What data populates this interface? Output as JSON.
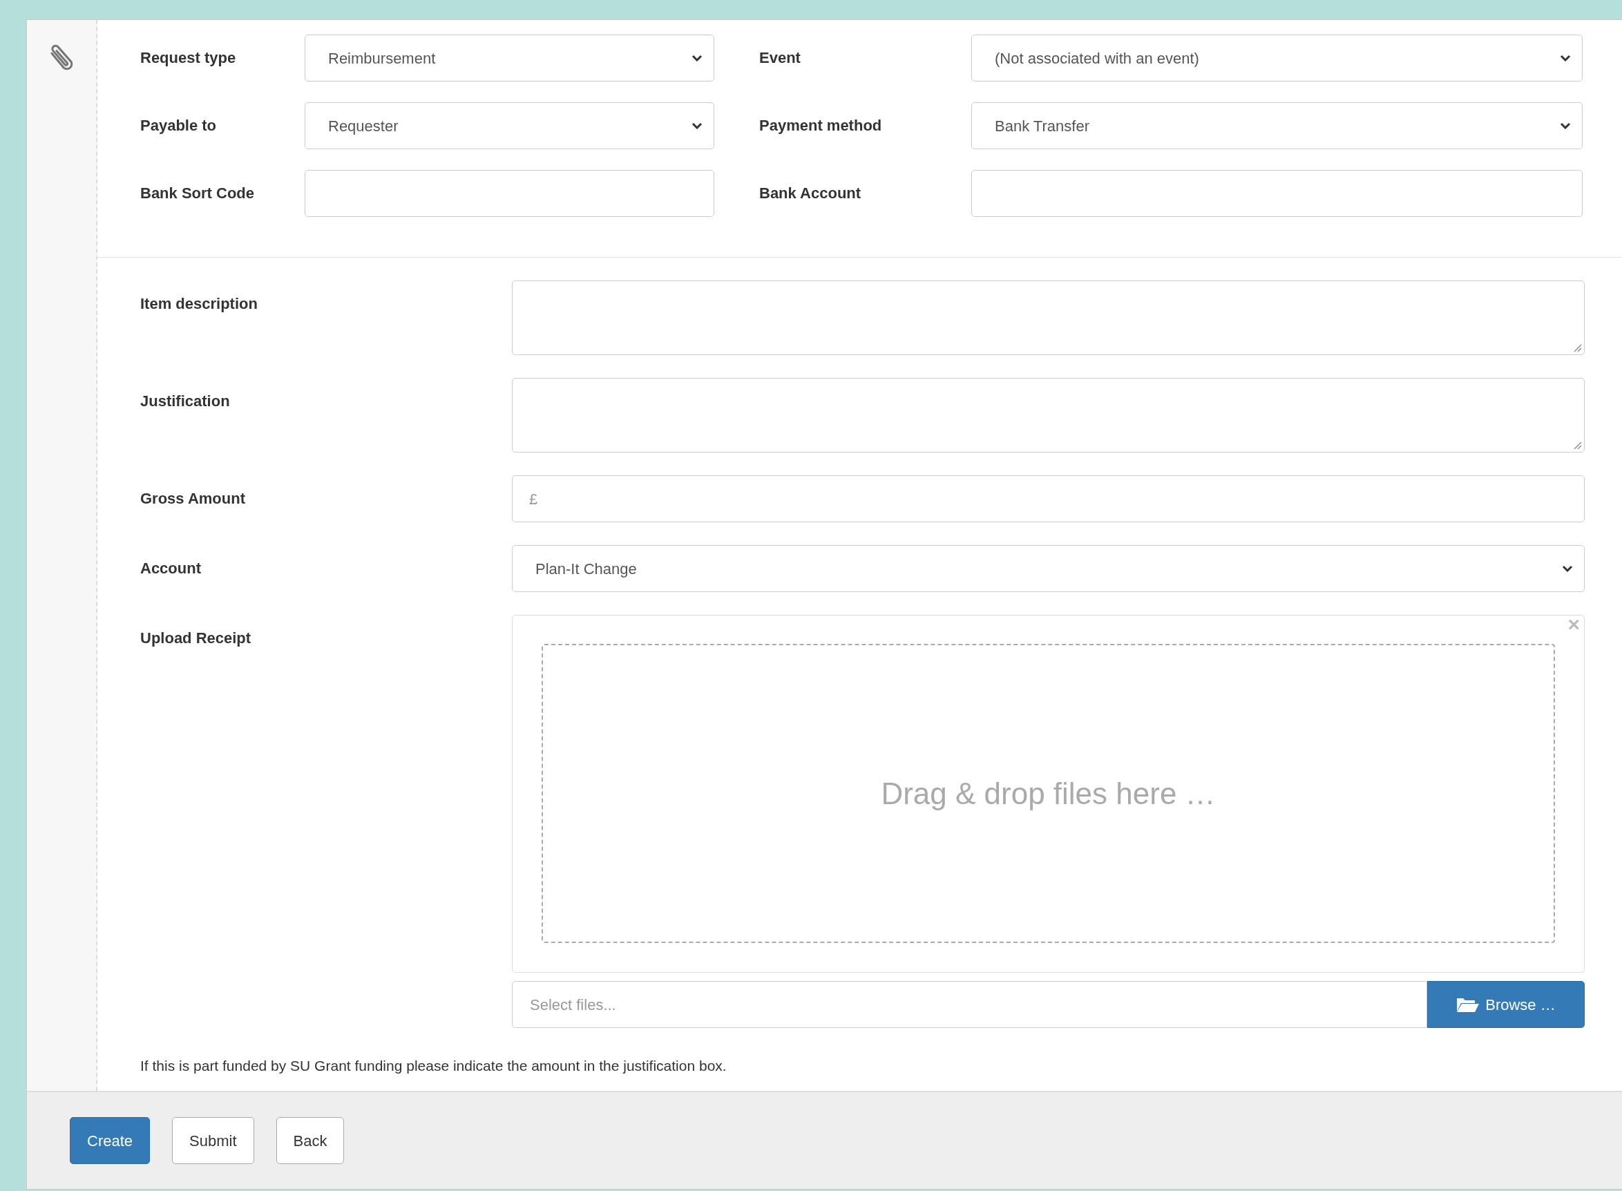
{
  "top_fields": [
    {
      "label": "Request type",
      "kind": "select",
      "value": "Reimbursement"
    },
    {
      "label": "Event",
      "kind": "select",
      "value": "(Not associated with an event)"
    },
    {
      "label": "Payable to",
      "kind": "select",
      "value": "Requester"
    },
    {
      "label": "Payment method",
      "kind": "select",
      "value": "Bank Transfer"
    },
    {
      "label": "Bank Sort Code",
      "kind": "input"
    },
    {
      "label": "Bank Account",
      "kind": "input"
    }
  ],
  "fields": [
    {
      "label": "Item description",
      "kind": "textarea"
    },
    {
      "label": "Justification",
      "kind": "textarea"
    },
    {
      "label": "Gross Amount",
      "kind": "amount",
      "placeholder": "£"
    },
    {
      "label": "Account",
      "kind": "select",
      "value": "Plan-It Change"
    },
    {
      "label": "Upload Receipt",
      "kind": "upload",
      "close": "×",
      "drop_text": "Drag & drop files here …",
      "file_placeholder": "Select files...",
      "browse": "Browse …"
    }
  ],
  "note": "If this is part funded by SU Grant funding please indicate the amount in the justification box.",
  "buttons": [
    {
      "label": "Create",
      "primary": true
    },
    {
      "label": "Submit",
      "primary": false
    },
    {
      "label": "Back",
      "primary": false
    }
  ]
}
